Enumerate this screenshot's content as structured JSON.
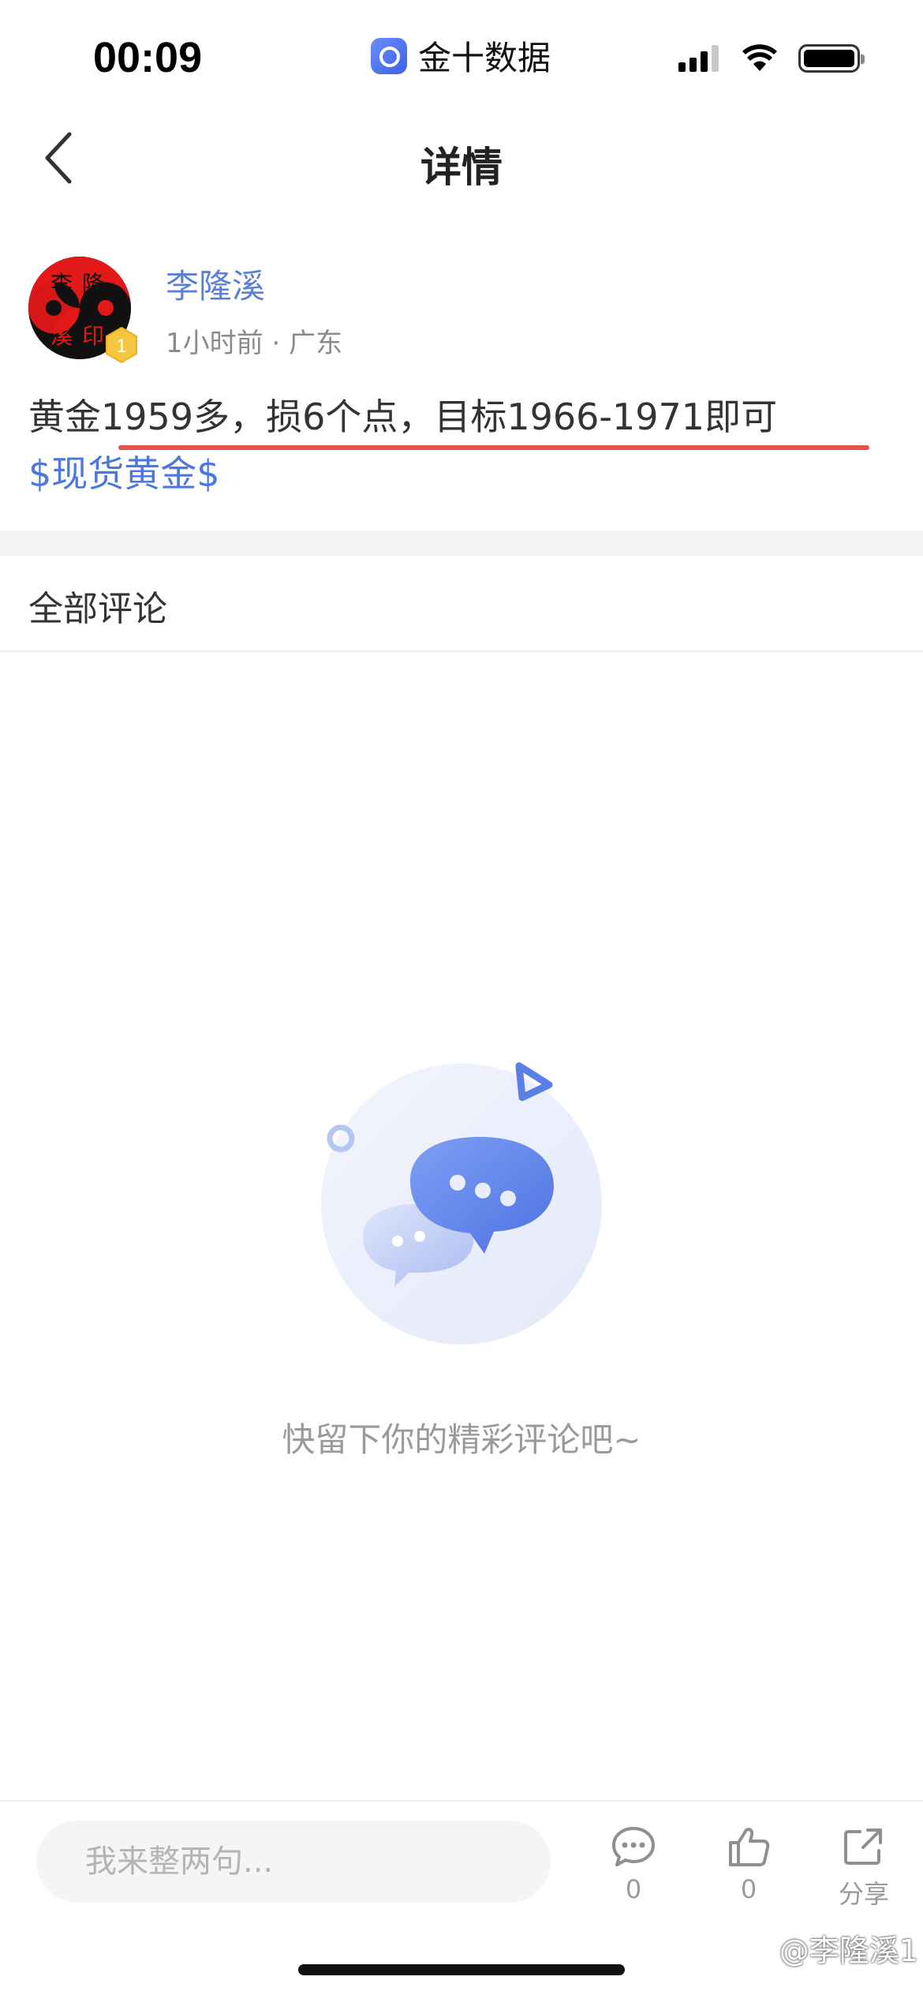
{
  "status_bar": {
    "time": "00:09",
    "app_name": "金十数据"
  },
  "nav": {
    "title": "详情",
    "back_icon": "chevron-left-icon"
  },
  "post": {
    "author_name": "李隆溪",
    "avatar_text": "李隆溪印",
    "level_badge": "1",
    "time": "1小时前",
    "separator": "·",
    "location": "广东",
    "content": "黄金1959多，损6个点，目标1966-1971即可",
    "tag": "$现货黄金$"
  },
  "comments": {
    "header": "全部评论",
    "empty_text": "快留下你的精彩评论吧~"
  },
  "bottom_bar": {
    "input_placeholder": "我来整两句...",
    "comment_count": "0",
    "like_count": "0",
    "share_label": "分享"
  },
  "watermark": "@李隆溪1",
  "colors": {
    "accent": "#4a78de",
    "author": "#5a7fd6",
    "underline": "#e0544c",
    "muted": "#9a9a9a"
  }
}
